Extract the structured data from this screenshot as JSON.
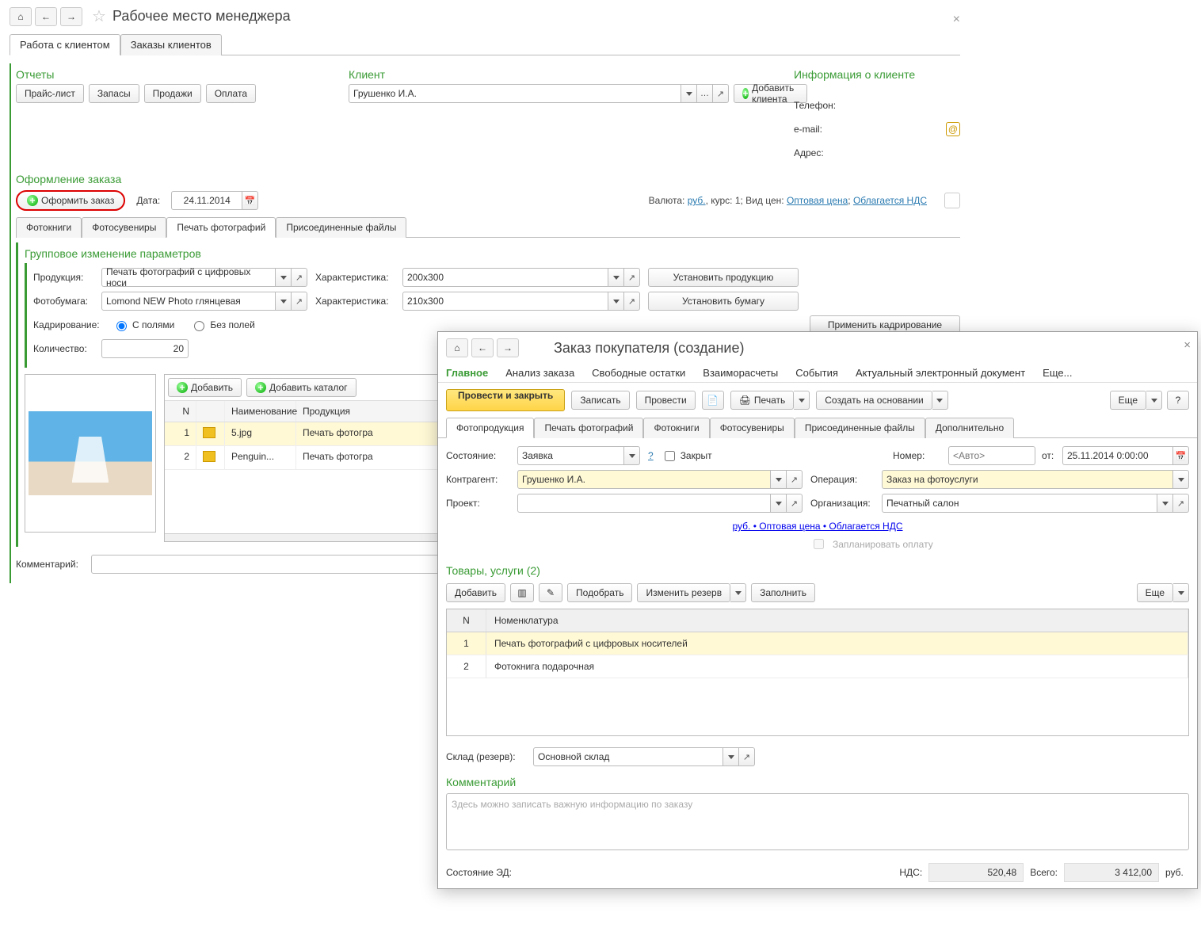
{
  "panelA": {
    "title": "Рабочее место менеджера",
    "mainTabs": [
      "Работа с клиентом",
      "Заказы клиентов"
    ],
    "sections": {
      "reports": {
        "title": "Отчеты",
        "buttons": [
          "Прайс-лист",
          "Запасы",
          "Продажи",
          "Оплата"
        ]
      },
      "client": {
        "title": "Клиент",
        "value": "Грушенко И.А.",
        "addBtn": "Добавить клиента"
      },
      "info": {
        "title": "Информация о клиенте",
        "rows": {
          "phone": "Телефон:",
          "email": "e-mail:",
          "addr": "Адрес:"
        }
      }
    },
    "order": {
      "title": "Оформление заказа",
      "createBtn": "Оформить заказ",
      "dateLbl": "Дата:",
      "date": "24.11.2014",
      "currencyInfo": {
        "prefix": "Валюта: ",
        "cur": "руб.",
        "t1": ", курс: 1; Вид цен: ",
        "pt": "Оптовая цена",
        "t2": "; ",
        "vat": "Облагается НДС"
      },
      "tabs": [
        "Фотокниги",
        "Фотосувениры",
        "Печать фотографий",
        "Присоединенные файлы"
      ],
      "group": {
        "title": "Групповое изменение параметров",
        "productLbl": "Продукция:",
        "productVal": "Печать фотографий  с цифровых носи",
        "char1Lbl": "Характеристика:",
        "char1Val": "200x300",
        "setProd": "Установить продукцию",
        "paperLbl": "Фотобумага:",
        "paperVal": "Lomond NEW Photo глянцевая",
        "char2Lbl": "Характеристика:",
        "char2Val": "210x300",
        "setPaper": "Установить бумагу",
        "cropLbl": "Кадрирование:",
        "cropOpt1": "С полями",
        "cropOpt2": "Без полей",
        "applyCrop": "Применить кадрирование",
        "qtyLbl": "Количество:",
        "qtyVal": "20"
      },
      "files": {
        "addBtn": "Добавить",
        "addCatBtn": "Добавить каталог",
        "cols": {
          "n": "N",
          "name": "Наименование",
          "prod": "Продукция"
        },
        "rows": [
          {
            "n": "1",
            "name": "5.jpg",
            "prod": "Печать фотогра"
          },
          {
            "n": "2",
            "name": "Penguin...",
            "prod": "Печать фотогра"
          }
        ]
      },
      "commentLbl": "Комментарий:"
    }
  },
  "panelB": {
    "title": "Заказ покупателя (создание)",
    "navTabs": [
      "Главное",
      "Анализ заказа",
      "Свободные остатки",
      "Взаиморасчеты",
      "События",
      "Актуальный электронный документ",
      "Еще..."
    ],
    "toolbar": {
      "post": "Провести и закрыть",
      "save": "Записать",
      "run": "Провести",
      "print": "Печать",
      "create": "Создать на основании",
      "more": "Еще"
    },
    "subTabs": [
      "Фотопродукция",
      "Печать фотографий",
      "Фотокниги",
      "Фотосувениры",
      "Присоединенные файлы",
      "Дополнительно"
    ],
    "form": {
      "stateLbl": "Состояние:",
      "stateVal": "Заявка",
      "closedLbl": "Закрыт",
      "numLbl": "Номер:",
      "numPh": "<Авто>",
      "fromLbl": "от:",
      "fromVal": "25.11.2014  0:00:00",
      "kontrLbl": "Контрагент:",
      "kontrVal": "Грушенко И.А.",
      "operLbl": "Операция:",
      "operVal": "Заказ на фотоуслуги",
      "projLbl": "Проект:",
      "orgLbl": "Организация:",
      "orgVal": "Печатный салон",
      "priceInfo": "руб. • Оптовая цена • Облагается НДС",
      "planLbl": "Запланировать оплату"
    },
    "goods": {
      "title": "Товары, услуги (2)",
      "add": "Добавить",
      "pick": "Подобрать",
      "reserve": "Изменить резерв",
      "fill": "Заполнить",
      "more": "Еще",
      "cols": {
        "n": "N",
        "name": "Номенклатура"
      },
      "rows": [
        {
          "n": "1",
          "name": "Печать фотографий  с цифровых носителей"
        },
        {
          "n": "2",
          "name": "Фотокнига подарочная"
        }
      ],
      "whLbl": "Склад (резерв):",
      "whVal": "Основной склад"
    },
    "comment": {
      "title": "Комментарий",
      "ph": "Здесь можно записать важную информацию по заказу"
    },
    "footer": {
      "edLbl": "Состояние ЭД:",
      "ndsLbl": "НДС:",
      "nds": "520,48",
      "totLbl": "Всего:",
      "tot": "3 412,00",
      "cur": "руб."
    }
  }
}
